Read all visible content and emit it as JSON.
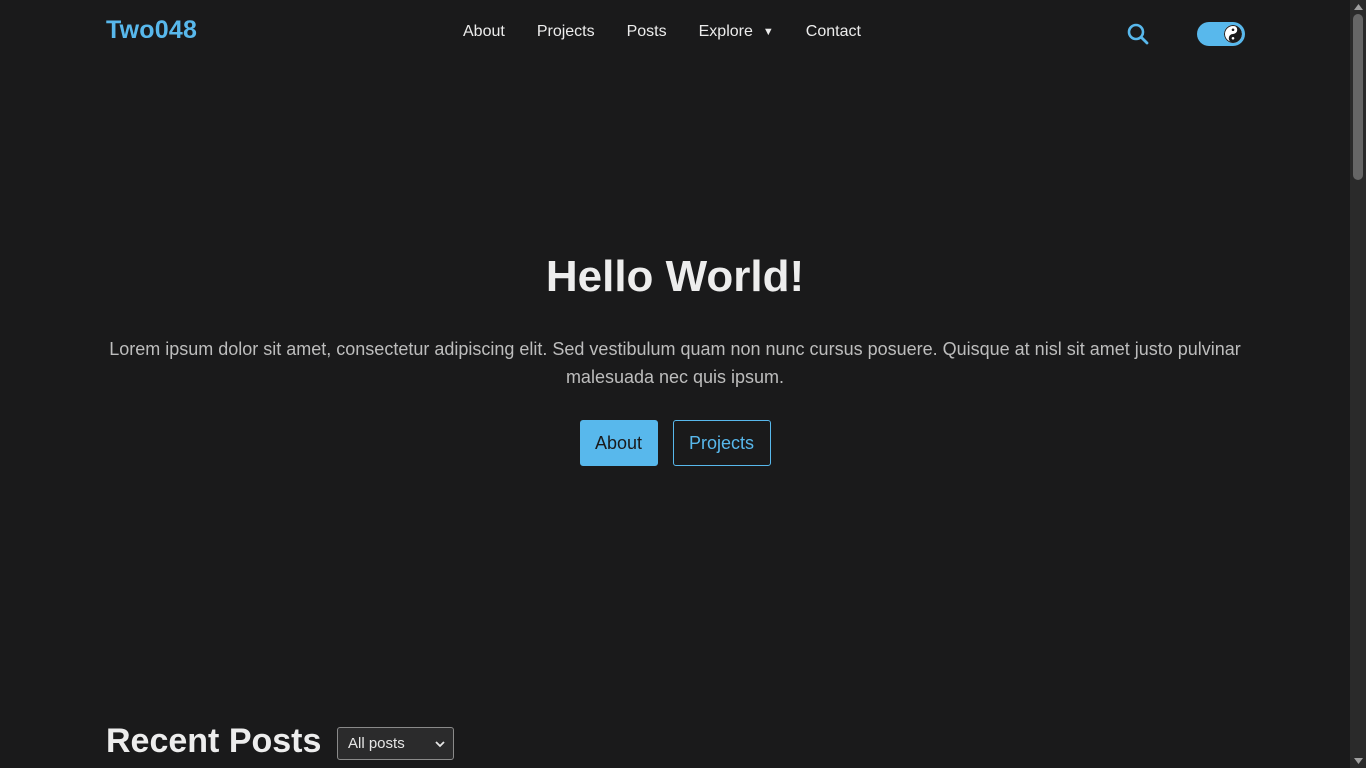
{
  "header": {
    "logo": "Two048",
    "nav": [
      {
        "label": "About"
      },
      {
        "label": "Projects"
      },
      {
        "label": "Posts"
      },
      {
        "label": "Explore",
        "icon": "caret-down-icon"
      },
      {
        "label": "Contact"
      }
    ],
    "search_icon": "search-icon",
    "theme_toggle_icon": "yin-yang-icon"
  },
  "hero": {
    "title": "Hello World!",
    "text": "Lorem ipsum dolor sit amet, consectetur adipiscing elit. Sed vestibulum quam non nunc cursus posuere. Quisque at nisl sit amet justo pulvinar malesuada nec quis ipsum.",
    "primary_button": "About",
    "secondary_button": "Projects"
  },
  "recent_posts": {
    "title": "Recent Posts",
    "filter_selected": "All posts"
  },
  "colors": {
    "background": "#1a1a1b",
    "accent": "#58b8ec",
    "text": "#ededed",
    "muted_text": "#bdbdbd"
  }
}
